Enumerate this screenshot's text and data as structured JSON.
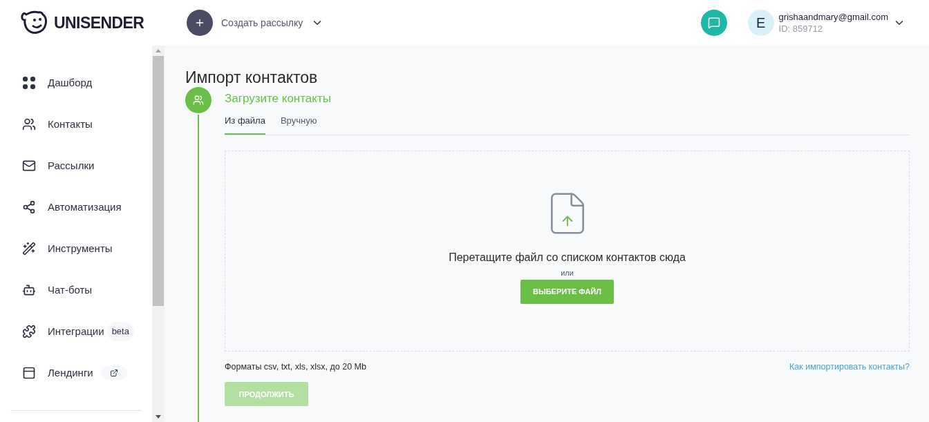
{
  "header": {
    "logo": "UNISENDER",
    "create_button": "Создать рассылку",
    "user": {
      "avatar_letter": "E",
      "email": "grishaandmary@gmail.com",
      "id": "ID: 859712"
    }
  },
  "sidebar": {
    "items": [
      {
        "label": "Дашборд"
      },
      {
        "label": "Контакты"
      },
      {
        "label": "Рассылки"
      },
      {
        "label": "Автоматизация"
      },
      {
        "label": "Инструменты"
      },
      {
        "label": "Чат-боты"
      },
      {
        "label": "Интеграции",
        "badge": "beta"
      },
      {
        "label": "Лендинги",
        "external": true
      }
    ]
  },
  "page": {
    "title": "Импорт контактов",
    "step_title": "Загрузите контакты",
    "tabs": [
      {
        "label": "Из файла",
        "selected": true
      },
      {
        "label": "Вручную",
        "selected": false
      }
    ],
    "dropzone": {
      "text": "Перетащите файл со списком контактов сюда",
      "or": "или",
      "button": "ВЫБЕРИТЕ ФАЙЛ"
    },
    "formats": "Форматы csv, txt, xls, xlsx, до 20 Mb",
    "help_link": "Как импортировать контакты?",
    "continue_button": {
      "label": "ПРОДОЛЖИТЬ",
      "disabled": true
    }
  }
}
